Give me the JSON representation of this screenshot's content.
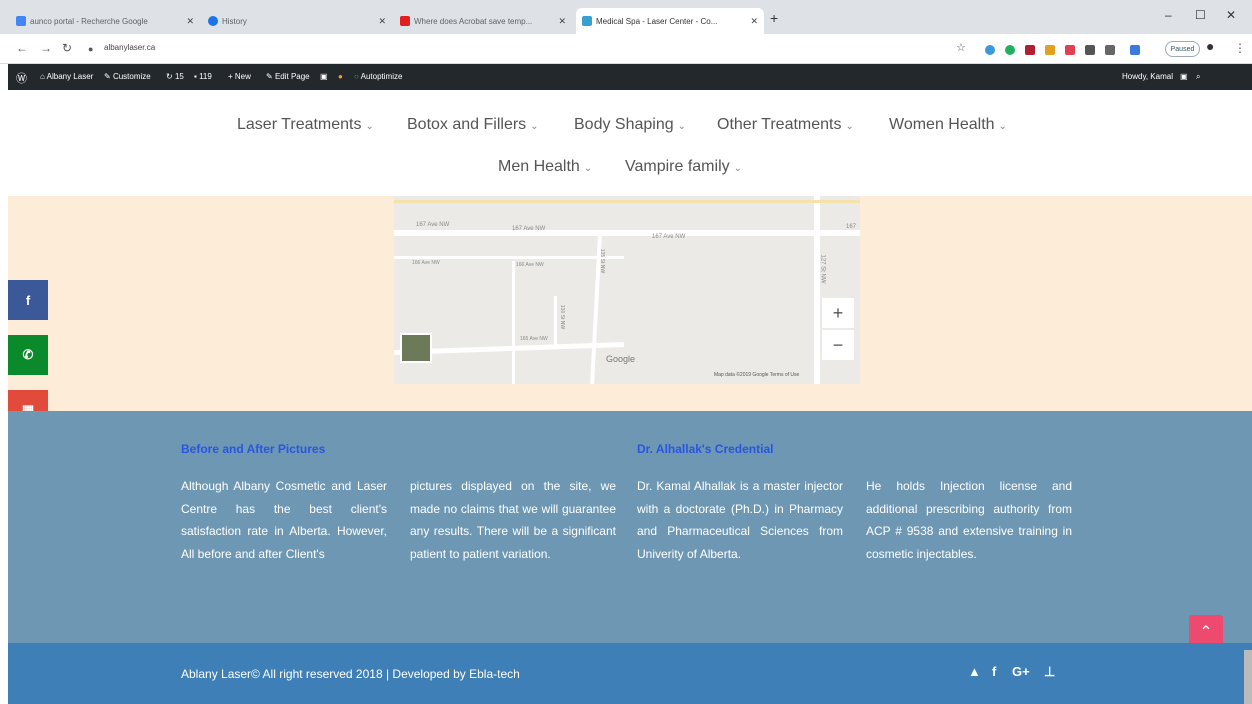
{
  "browser": {
    "tabs": [
      {
        "title": "aunco portal - Recherche Google",
        "color": "#4285f4"
      },
      {
        "title": "History",
        "color": "#1a73e8"
      },
      {
        "title": "Where does Acrobat save temp...",
        "color": "#e02020"
      },
      {
        "title": "Medical Spa - Laser Center - Co...",
        "color": "#38a0d0"
      }
    ],
    "new_tab": "+",
    "url": "albanylaser.ca",
    "paused_label": "Paused",
    "window_controls": [
      "–",
      "☐",
      "✕"
    ]
  },
  "wpbar": {
    "items": [
      "Albany Laser",
      "Customize",
      "15",
      "119",
      "New",
      "Edit Page",
      "Autoptimize"
    ],
    "greeting": "Howdy, Kamal"
  },
  "nav": {
    "row1": [
      "Laser Treatments",
      "Botox and Fillers",
      "Body Shaping",
      "Other Treatments",
      "Women Health"
    ],
    "row2": [
      "Men Health",
      "Vampire family"
    ]
  },
  "map": {
    "labels": [
      "167 Ave NW",
      "167 Ave NW",
      "167 Ave NW",
      "166 Ave NW",
      "166 Ave NW",
      "165 Ave NW",
      "127 St NW",
      "135 St NW",
      "130 St NW",
      "167"
    ],
    "zoom_in": "+",
    "zoom_out": "−",
    "google": "Google",
    "attribution": "Map data ©2019 Google   Terms of Use"
  },
  "social": [
    {
      "icon": "facebook-icon",
      "glyph": "f",
      "color": "#3b5998"
    },
    {
      "icon": "phone-icon",
      "glyph": "✆",
      "color": "#0a8a2a"
    },
    {
      "icon": "map-icon",
      "glyph": "▦",
      "color": "#e24b3b"
    },
    {
      "icon": "youtube-icon",
      "glyph": "▲",
      "color": "#c4151a"
    }
  ],
  "footer": {
    "col1_title": "Before and After Pictures",
    "col1_text": "Although Albany Cosmetic and Laser Centre has the best client's satisfaction rate in Alberta. However, All before and after Client's",
    "col2_text": "pictures displayed on the site, we made no claims that we will guarantee any results. There will be a significant patient to patient variation.",
    "col3_title": "Dr. Alhallak's Credential",
    "col3_text": "Dr. Kamal Alhallak is a master injector with a doctorate (Ph.D.) in Pharmacy and Pharmaceutical Sciences from Univerity of Alberta.",
    "col4_text": "He holds Injection license and additional prescribing authority from ACP # 9538 and extensive training in cosmetic injectables.",
    "copyright": "Ablany Laser© All right reserved 2018 | Developed by Ebla-tech",
    "icons": [
      "youtube-icon",
      "facebook-icon",
      "google-plus-icon",
      "sitemap-icon"
    ]
  }
}
